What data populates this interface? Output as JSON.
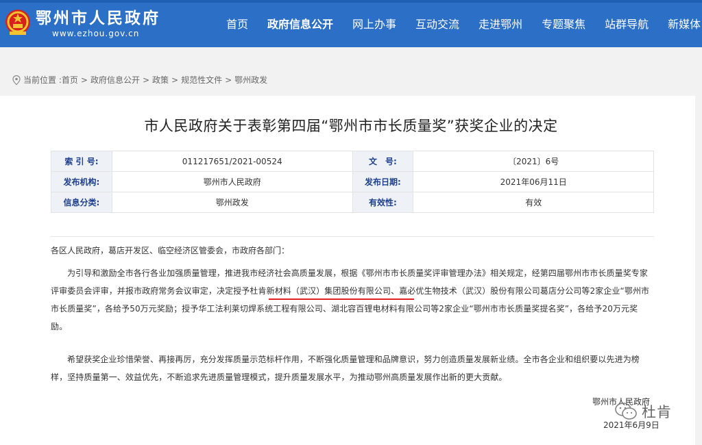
{
  "header": {
    "site_name": "鄂州市人民政府",
    "site_url": "www.ezhou.gov.cn",
    "nav": [
      "首页",
      "政府信息公开",
      "网上办事",
      "互动交流",
      "走进鄂州",
      "专题聚焦",
      "站群导航",
      "新媒体"
    ]
  },
  "breadcrumb": {
    "prefix": "当前位置 :",
    "items": [
      "首页",
      "政府信息公开",
      "政策",
      "规范性文件",
      "鄂州政发"
    ],
    "separator": ">"
  },
  "document": {
    "title": "市人民政府关于表彰第四届“鄂州市市长质量奖”获奖企业的决定",
    "meta": {
      "index_label": "索 引 号:",
      "index_value": "011217651/2021-00524",
      "doc_no_label": "文　号:",
      "doc_no_value": "〔2021〕6号",
      "org_label": "发布机构:",
      "org_value": "鄂州市人民政府",
      "date_label": "发布日期:",
      "date_value": "2021年06月11日",
      "category_label": "信息分类:",
      "category_value": "鄂州政发",
      "validity_label": "有效性:",
      "validity_value": "有效"
    },
    "salutation": "各区人民政府，葛店开发区、临空经济区管委会，市政府各部门：",
    "para2": "为引导和激励全市各行各业加强质量管理，推进我市经济社会高质量发展，根据《鄂州市市长质量奖评审管理办法》相关规定，经第四届鄂州市市长质量奖专家评审委员会评审，并报市政府常务会议审定，决定授予杜肯新材料（武汉）集团股份有限公司、嘉必优生物技术（武汉）股份有限公司葛店分公司等2家企业“鄂州市市长质量奖”，各给予50万元奖励；授予华工法利莱切焊系统工程有限公司、湖北容百锂电材料有限公司等2家企业“鄂州市市长质量奖提名奖”，各给予20万元奖励。",
    "para3": "希望获奖企业珍惜荣誉、再接再厉，充分发挥质量示范标杆作用，不断强化质量管理和品牌意识，努力创造质量发展新业绩。全市各企业和组织要以先进为榜样，坚持质量第一、效益优先，不断追求先进质量管理模式，提升质量发展水平，为推动鄂州高质量发展作出新的更大贡献。",
    "signature_org": "鄂州市人民政府",
    "signature_date": "2021年6月9日"
  },
  "watermark": {
    "text": "杜肯"
  }
}
